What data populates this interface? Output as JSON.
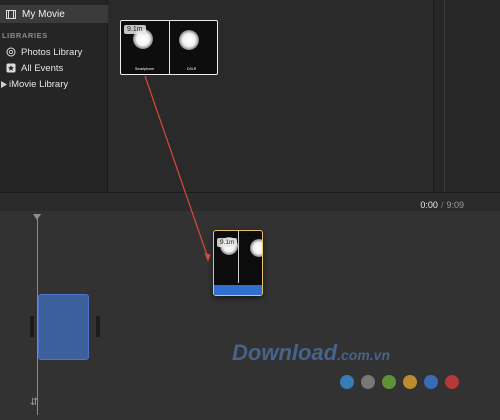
{
  "sidebar": {
    "current_project": "My Movie",
    "section_label": "LIBRARIES",
    "items": [
      {
        "label": "Photos Library",
        "icon": "photos-icon"
      },
      {
        "label": "All Events",
        "icon": "star-icon"
      },
      {
        "label": "iMovie Library",
        "icon": "disclosure-triangle-icon"
      }
    ]
  },
  "browser": {
    "clip": {
      "duration": "9.1m",
      "left_label": "Smartphone",
      "right_label": "DSLR"
    }
  },
  "timeline": {
    "current_time": "0:00",
    "separator": "/",
    "total_time": "9:09",
    "dragged_clip": {
      "duration": "9.1m"
    }
  },
  "watermark": {
    "text": "Download",
    "suffix": ".com.vn",
    "dot_colors": [
      "#3a8fd8",
      "#8a8a8a",
      "#6aaa3a",
      "#e0a030",
      "#3a7ad8",
      "#d83a3a"
    ]
  },
  "colors": {
    "arrow": "#d9483a",
    "selection_border": "#e8c26a",
    "drop_zone": "#3e5f9e",
    "audio_track": "#2f6fd0"
  }
}
